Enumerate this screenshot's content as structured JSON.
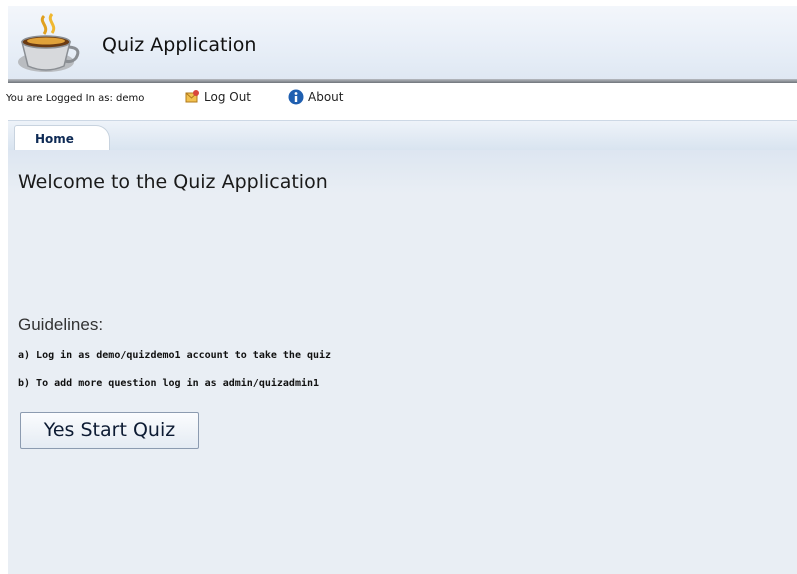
{
  "header": {
    "title": "Quiz Application",
    "logo_icon": "coffee-cup-icon"
  },
  "userbar": {
    "logged_in_text": "You are Logged In as: demo",
    "logout_label": "Log Out",
    "logout_icon": "logout-icon",
    "about_label": "About",
    "about_icon": "info-icon"
  },
  "tabs": [
    {
      "label": "Home",
      "selected": true
    }
  ],
  "main": {
    "welcome": "Welcome to the Quiz Application",
    "guidelines_title": "Guidelines:",
    "guidelines": [
      "a) Log in as demo/quizdemo1 account to take the quiz",
      "b) To add more question log in as admin/quizadmin1"
    ],
    "start_button_label": "Yes Start Quiz"
  },
  "colors": {
    "tab_text": "#0e2a55",
    "content_bg": "#e9eef4",
    "header_bg": "#e7eef7"
  }
}
